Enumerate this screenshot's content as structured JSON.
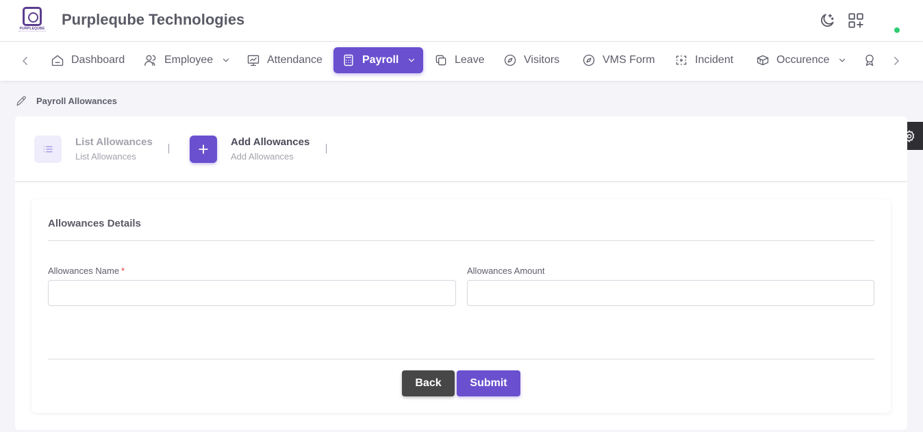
{
  "header": {
    "logo_text": "PURPLEQUBE",
    "brand": "Purpleqube Technologies",
    "icons": [
      "moon-sparkle-icon",
      "apps-add-icon"
    ]
  },
  "nav": {
    "items": [
      {
        "label": "Dashboard",
        "icon": "home-icon"
      },
      {
        "label": "Employee",
        "icon": "users-icon",
        "has_dropdown": true
      },
      {
        "label": "Attendance",
        "icon": "presentation-chart-icon"
      },
      {
        "label": "Payroll",
        "icon": "calculator-icon",
        "has_dropdown": true,
        "active": true
      },
      {
        "label": "Leave",
        "icon": "copy-icon"
      },
      {
        "label": "Visitors",
        "icon": "compass-icon"
      },
      {
        "label": "VMS Form",
        "icon": "compass-icon"
      },
      {
        "label": "Incident",
        "icon": "focus-icon"
      },
      {
        "label": "Occurence",
        "icon": "boxes-icon",
        "has_dropdown": true
      }
    ]
  },
  "breadcrumb": "Payroll Allowances",
  "steps": [
    {
      "title": "List Allowances",
      "subtitle": "List Allowances",
      "state": "inactive"
    },
    {
      "title": "Add Allowances",
      "subtitle": "Add Allowances",
      "state": "active"
    }
  ],
  "form": {
    "section_title": "Allowances Details",
    "name_label": "Allowances Name",
    "required_mark": "*",
    "amount_label": "Allowances Amount",
    "name_value": "",
    "amount_value": "",
    "back_label": "Back",
    "submit_label": "Submit"
  },
  "colors": {
    "accent": "#6a50cf",
    "back_button": "#474747",
    "online": "#2ecc71",
    "required": "#e03b3b"
  }
}
